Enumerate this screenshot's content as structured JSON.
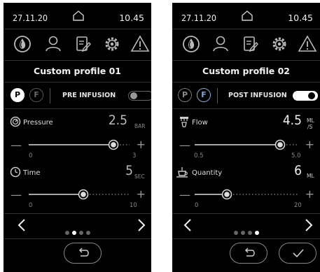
{
  "panels": [
    {
      "status": {
        "date": "27.11.20",
        "time": "10.45"
      },
      "title": "Custom profile 01",
      "mode_buttons": {
        "p": "P",
        "f": "F"
      },
      "mode_label": "PRE INFUSION",
      "toggle_on": false,
      "params": [
        {
          "name": "Pressure",
          "value": "2.5",
          "unit": "BAR",
          "min_label": "0",
          "max_label": "3",
          "level": 0.84
        },
        {
          "name": "Time",
          "value": "5",
          "unit": "SEC",
          "min_label": "0",
          "max_label": "10",
          "level": 0.5
        }
      ],
      "page_dots": 4,
      "active_dot": 1
    },
    {
      "status": {
        "date": "27.11.20",
        "time": "10.45"
      },
      "title": "Custom profile 02",
      "mode_buttons": {
        "p": "P",
        "f": "F"
      },
      "mode_label": "POST INFUSION",
      "toggle_on": true,
      "params": [
        {
          "name": "Flow",
          "value": "4.5",
          "unit_top": "ML",
          "unit_bottom": "/S",
          "min_label": "0.5",
          "max_label": "5.0",
          "level": 0.89
        },
        {
          "name": "Quantity",
          "value": "6",
          "unit": "ML",
          "min_label": "0",
          "max_label": "20",
          "level": 0.3
        }
      ],
      "page_dots": 4,
      "active_dot": 3
    }
  ],
  "icons": [
    "home-icon",
    "water-drop-icon",
    "user-icon",
    "clipboard-edit-icon",
    "settings-gear-icon",
    "warning-icon",
    "pressure-gauge-icon",
    "clock-icon",
    "shower-head-icon",
    "cup-icon",
    "back-arrow-icon",
    "check-icon",
    "chevron-left-icon",
    "chevron-right-icon"
  ],
  "colors": {
    "background": "#000000",
    "text": "#e6e6e6",
    "accent_blue": "#8aa6d6"
  }
}
